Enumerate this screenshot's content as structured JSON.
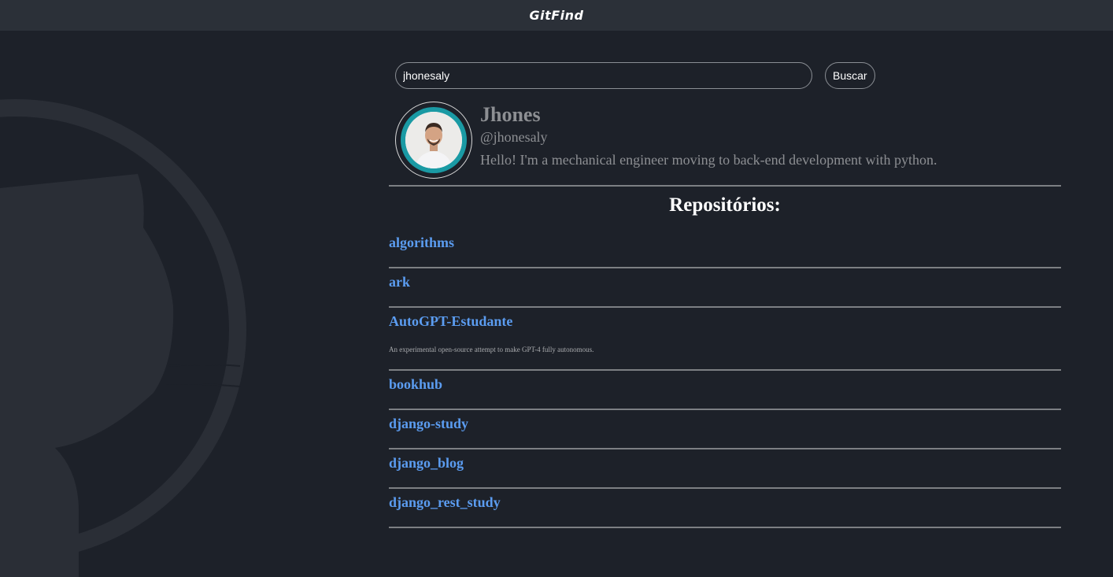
{
  "app": {
    "title": "GitFind"
  },
  "search": {
    "value": "jhonesaly",
    "button_label": "Buscar"
  },
  "profile": {
    "name": "Jhones",
    "login": "@jhonesaly",
    "bio": "Hello! I'm a mechanical engineer moving to back-end development with python."
  },
  "repositories": {
    "heading": "Repositórios:",
    "items": [
      {
        "name": "algorithms",
        "description": ""
      },
      {
        "name": "ark",
        "description": ""
      },
      {
        "name": "AutoGPT-Estudante",
        "description": "An experimental open-source attempt to make GPT-4 fully autonomous."
      },
      {
        "name": "bookhub",
        "description": ""
      },
      {
        "name": "django-study",
        "description": ""
      },
      {
        "name": "django_blog",
        "description": ""
      },
      {
        "name": "django_rest_study",
        "description": ""
      }
    ]
  },
  "colors": {
    "background": "#1d2129",
    "topbar": "#2b3038",
    "link": "#5b9cf0",
    "muted_text": "#8d8f93",
    "divider": "#7c7f83",
    "avatar_ring": "#1a9aa4"
  }
}
